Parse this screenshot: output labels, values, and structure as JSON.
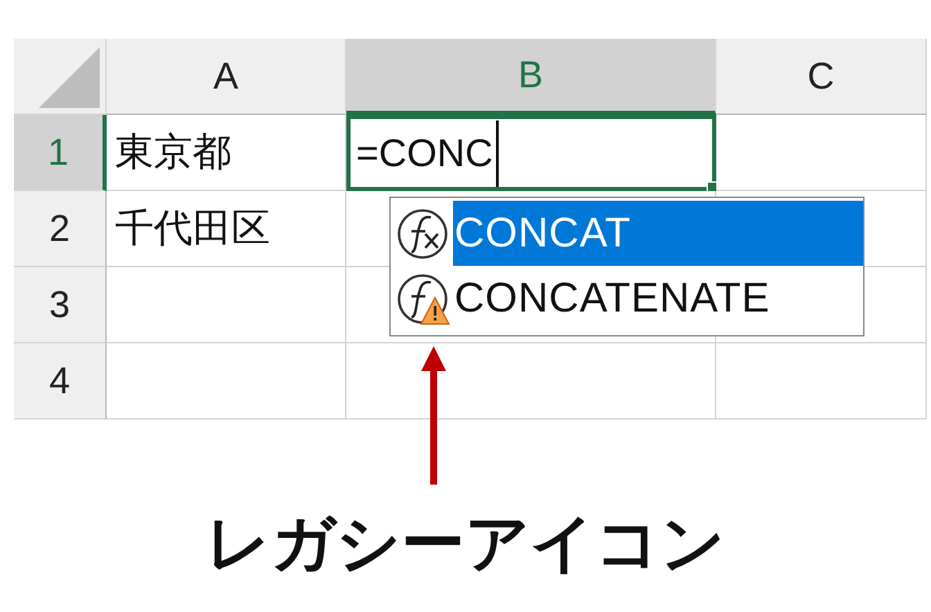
{
  "sheet": {
    "columns": [
      {
        "label": "A",
        "selected": false
      },
      {
        "label": "B",
        "selected": true
      },
      {
        "label": "C",
        "selected": false
      }
    ],
    "rows": [
      {
        "label": "1",
        "selected": true,
        "cells": [
          {
            "text": "東京都",
            "editing": false
          },
          {
            "text": "=CONC",
            "editing": true
          }
        ]
      },
      {
        "label": "2",
        "selected": false,
        "cells": [
          {
            "text": "千代田区",
            "editing": false
          }
        ]
      },
      {
        "label": "3",
        "selected": false
      },
      {
        "label": "4",
        "selected": false
      }
    ]
  },
  "autocomplete": {
    "items": [
      {
        "label": "CONCAT",
        "kind": "function",
        "selected": true
      },
      {
        "label": "CONCATENATE",
        "kind": "legacy",
        "selected": false
      }
    ]
  },
  "annotation": {
    "caption": "レガシーアイコン"
  }
}
